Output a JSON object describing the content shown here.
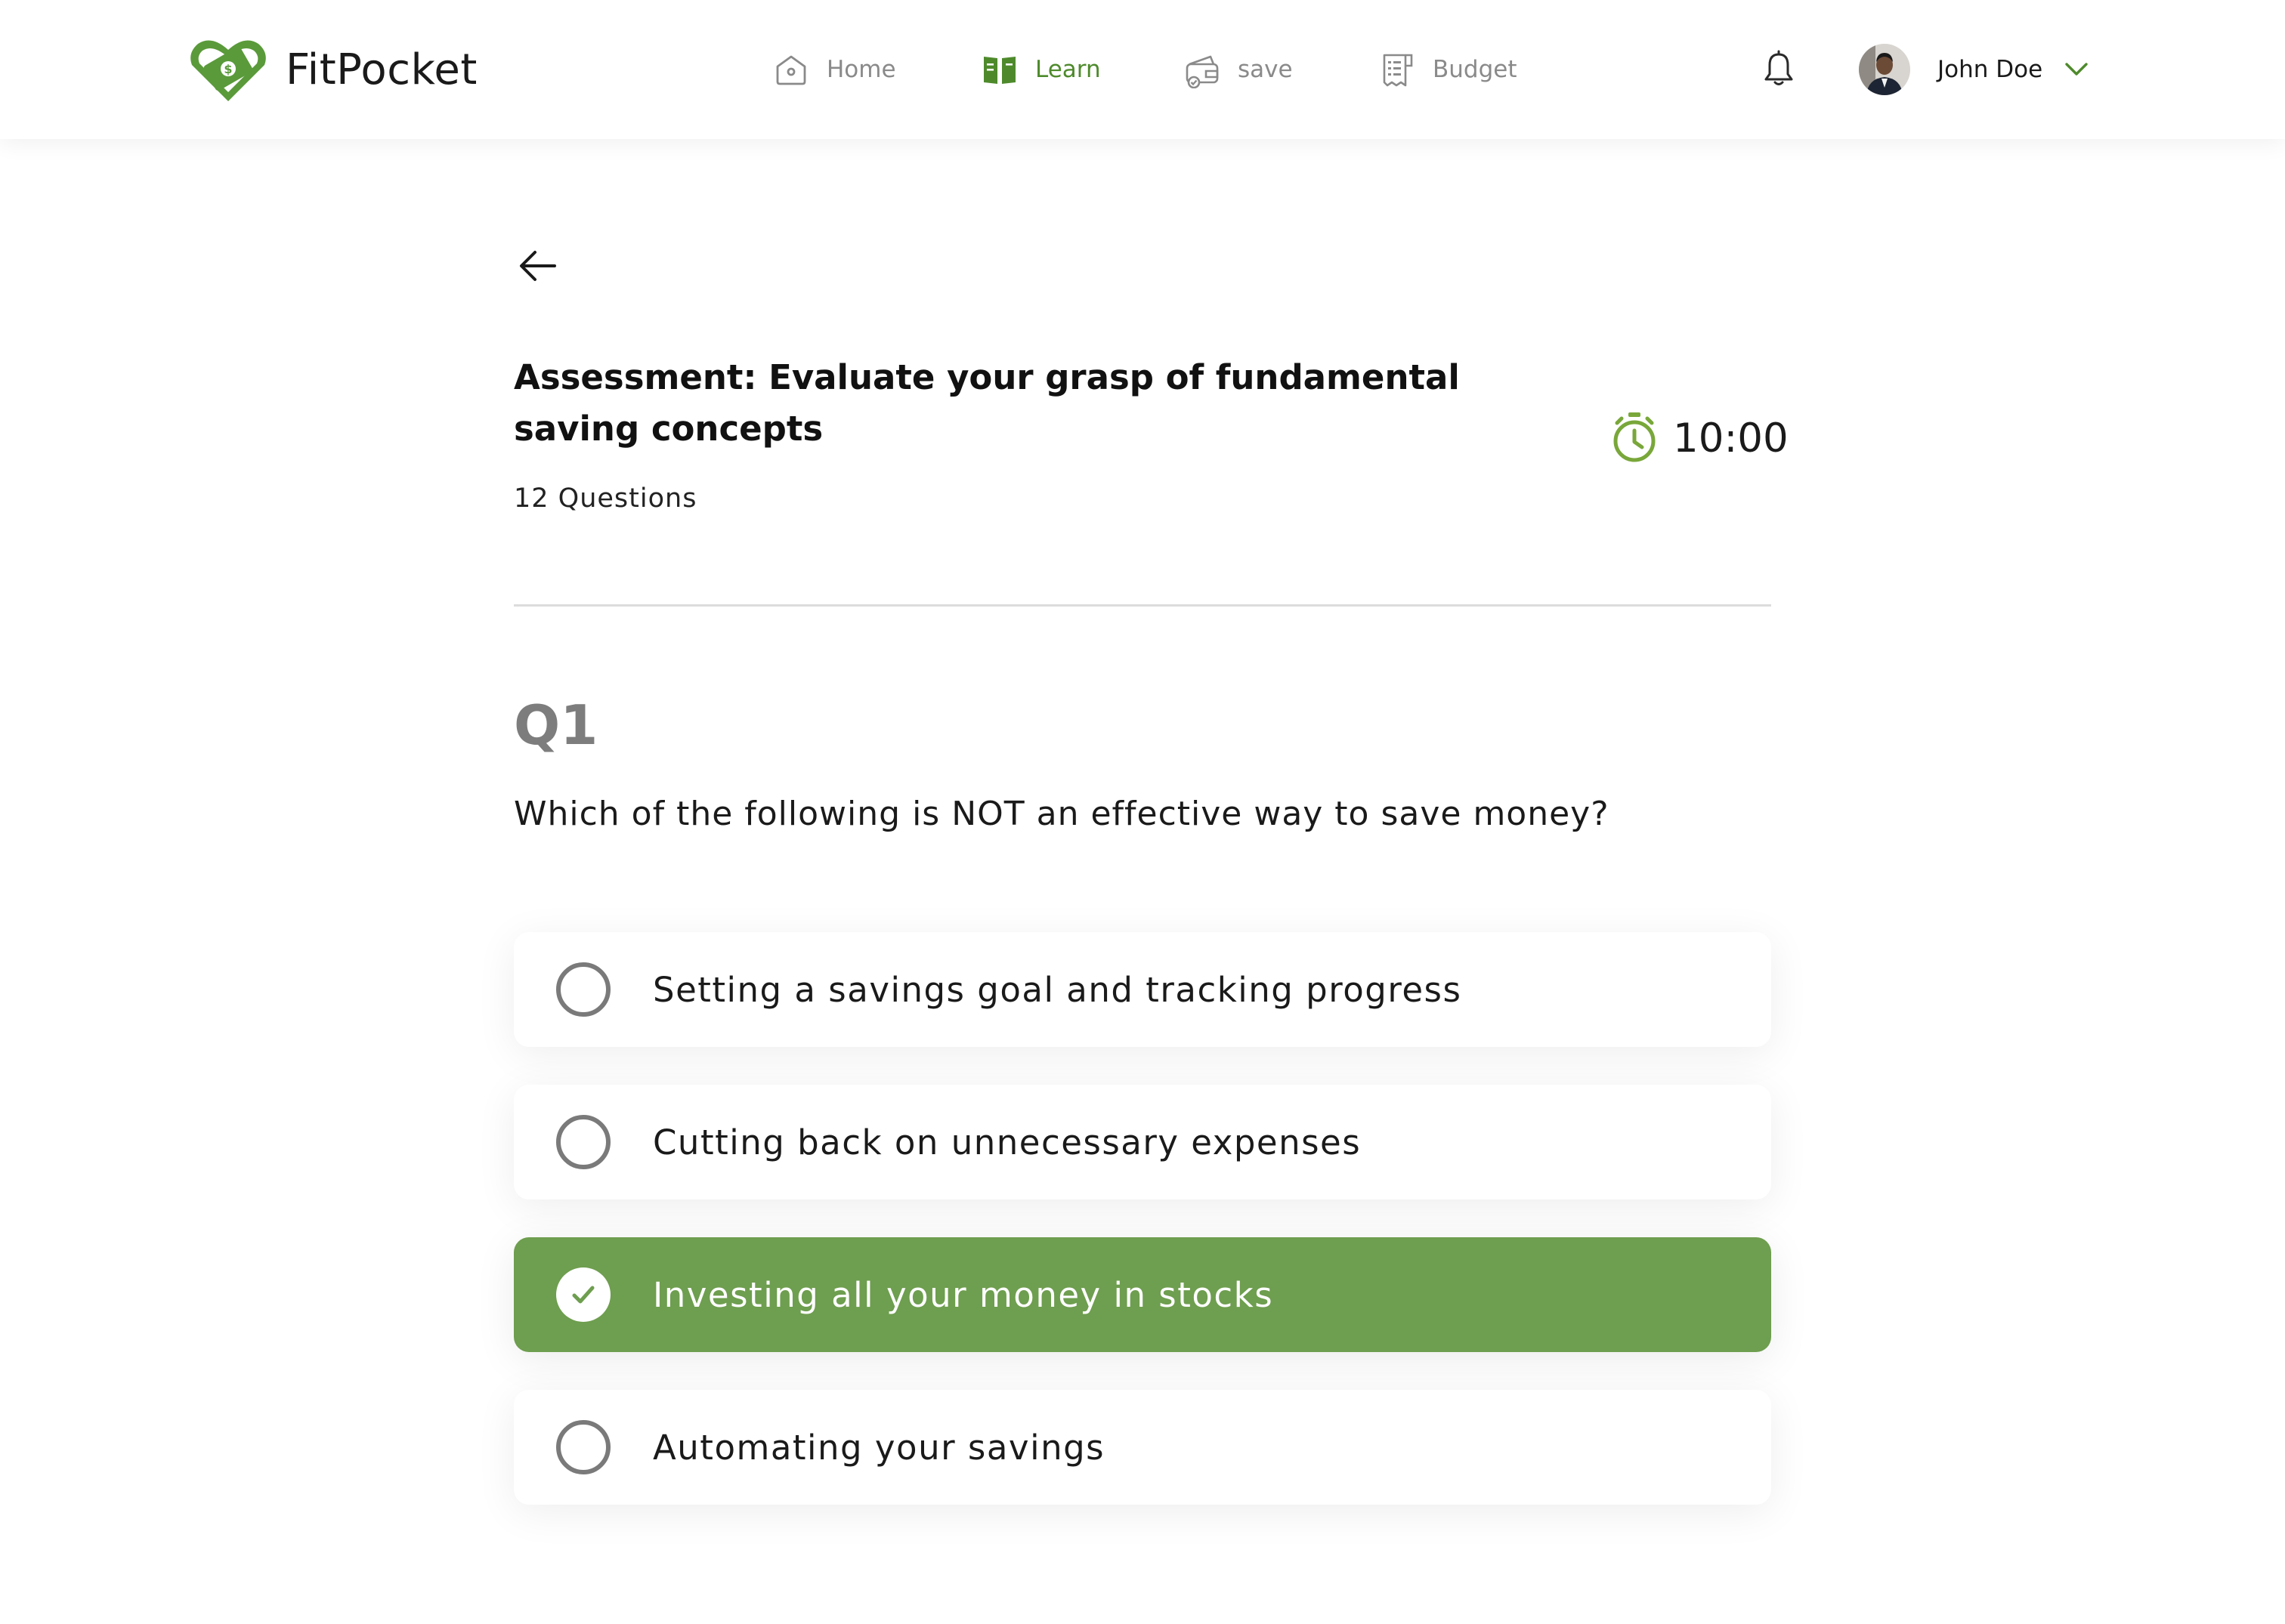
{
  "brand": {
    "name": "FitPocket"
  },
  "nav": [
    {
      "label": "Home",
      "icon": "home-icon",
      "active": false
    },
    {
      "label": "Learn",
      "icon": "book-icon",
      "active": true
    },
    {
      "label": "save",
      "icon": "wallet-icon",
      "active": false
    },
    {
      "label": "Budget",
      "icon": "receipt-icon",
      "active": false
    }
  ],
  "user": {
    "name": "John Doe"
  },
  "assessment": {
    "title": "Assessment: Evaluate your grasp of fundamental saving concepts",
    "question_count": "12 Questions",
    "timer": "10:00"
  },
  "question": {
    "number": "Q1",
    "text": "Which of the following is NOT an effective way to save money?",
    "options": [
      {
        "label": "Setting a savings goal and tracking progress",
        "selected": false
      },
      {
        "label": "Cutting back on unnecessary expenses",
        "selected": false
      },
      {
        "label": "Investing all your money in stocks",
        "selected": true
      },
      {
        "label": "Automating your savings",
        "selected": false
      }
    ]
  },
  "colors": {
    "accent": "#6e9e4f",
    "nav_active": "#4e8a2c",
    "timer_icon": "#79a73a",
    "radio_border": "#7a7a7a"
  }
}
